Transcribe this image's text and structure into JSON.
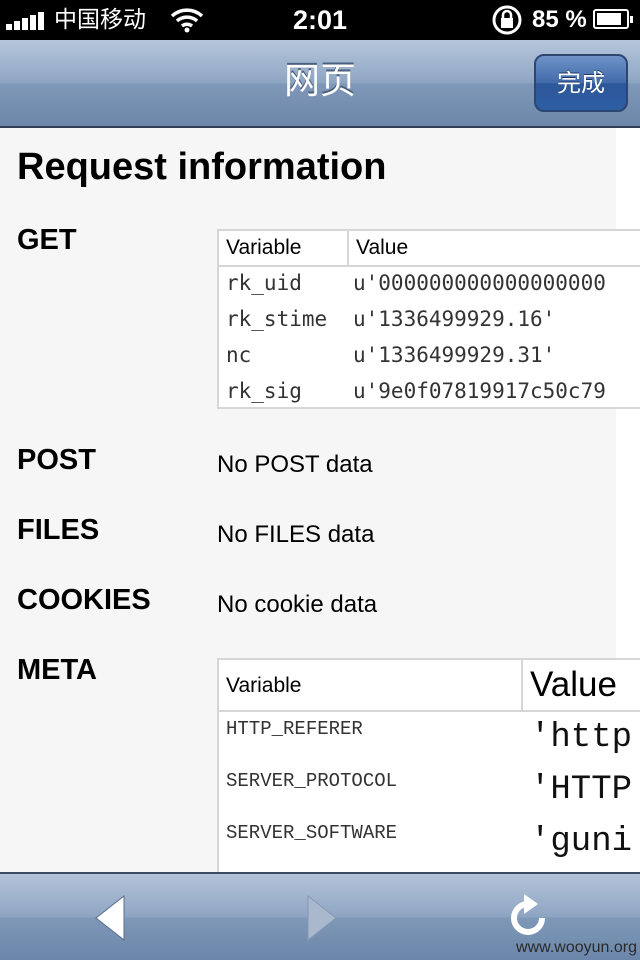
{
  "status_bar": {
    "carrier": "中国移动",
    "time": "2:01",
    "battery_text": "85 %",
    "battery_level": 0.85
  },
  "nav": {
    "title": "网页",
    "done_label": "完成"
  },
  "page": {
    "title": "Request information",
    "get": {
      "label": "GET",
      "headers": [
        "Variable",
        "Value"
      ],
      "rows": [
        {
          "key": "rk_uid",
          "value": "u'000000000000000000"
        },
        {
          "key": "rk_stime",
          "value": "u'1336499929.16'"
        },
        {
          "key": "nc",
          "value": "u'1336499929.31'"
        },
        {
          "key": "rk_sig",
          "value": "u'9e0f07819917c50c79"
        }
      ]
    },
    "post": {
      "label": "POST",
      "text": "No POST data"
    },
    "files": {
      "label": "FILES",
      "text": "No FILES data"
    },
    "cookies": {
      "label": "COOKIES",
      "text": "No cookie data"
    },
    "meta": {
      "label": "META",
      "headers": [
        "Variable",
        "Value"
      ],
      "rows": [
        {
          "key": "HTTP_REFERER",
          "value": "'http"
        },
        {
          "key": "SERVER_PROTOCOL",
          "value": "'HTTP"
        },
        {
          "key": "SERVER_SOFTWARE",
          "value": "'guni"
        }
      ]
    }
  },
  "toolbar": {
    "back_icon": "back-arrow-icon",
    "forward_icon": "forward-arrow-icon",
    "reload_icon": "reload-icon"
  },
  "watermark": "www.wooyun.org",
  "colors": {
    "nav_accent": "#8ea5c2",
    "done_button": "#416ba9",
    "page_background": "#f6f6f6"
  }
}
